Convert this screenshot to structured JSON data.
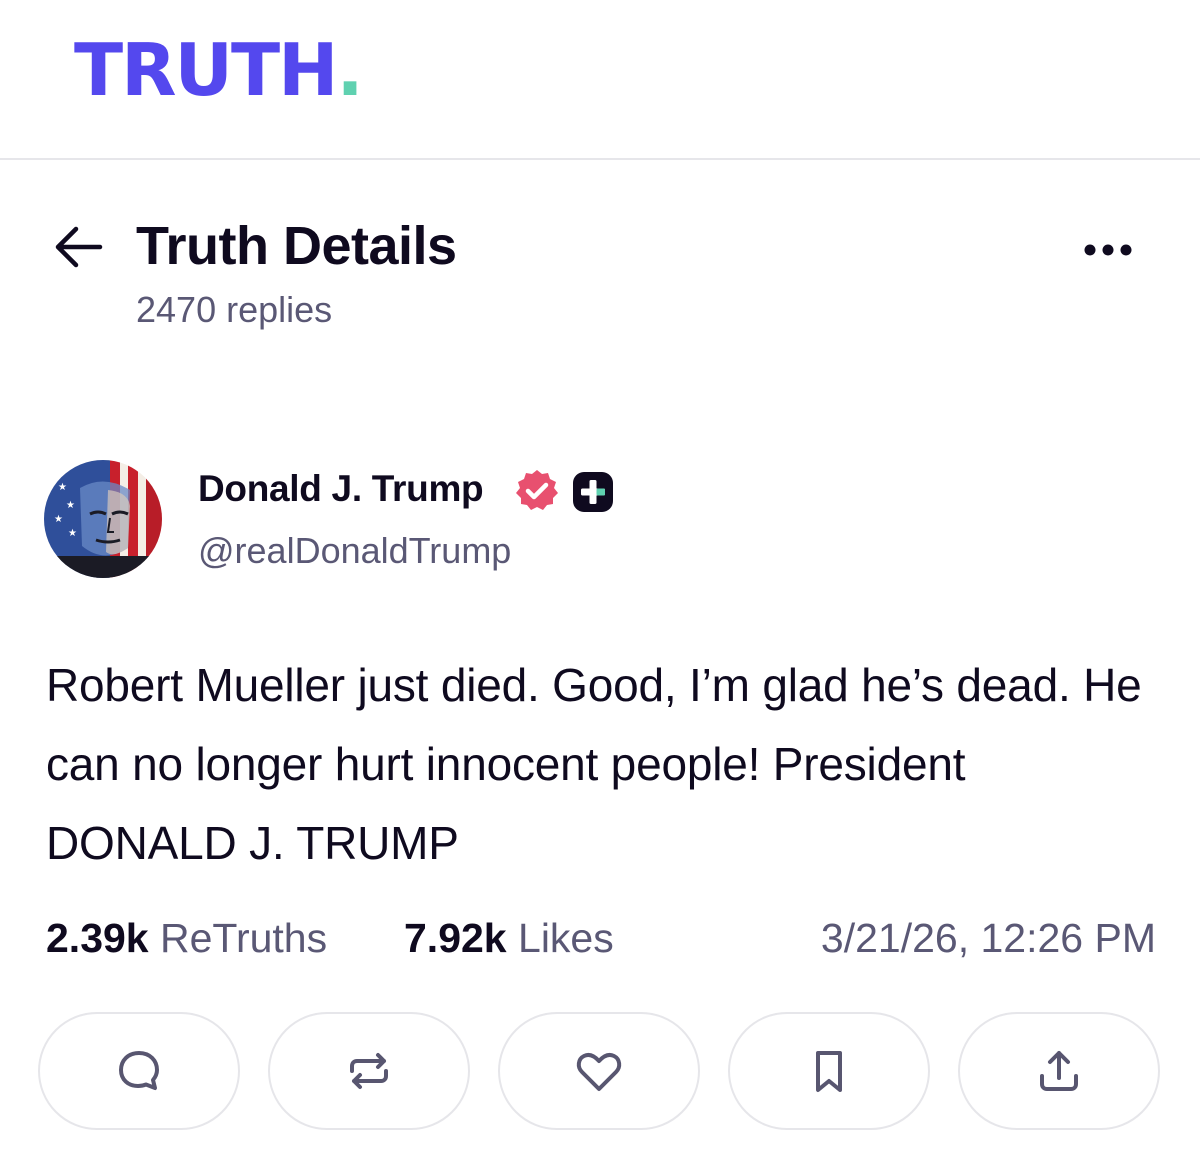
{
  "brand": {
    "logo_text": "TRUTH",
    "logo_dot": ".",
    "logo_color": "#5448ee",
    "dot_color": "#5fd1b0"
  },
  "header": {
    "back_icon": "arrow-left-icon",
    "title": "Truth Details",
    "replies": "2470 replies",
    "more_icon": "more-horizontal-icon"
  },
  "post": {
    "author": {
      "name": "Donald J. Trump",
      "handle": "@realDonaldTrump",
      "verified_icon": "verified-badge-icon",
      "verified_color": "#e8506f",
      "plus_icon": "plus-badge-icon"
    },
    "text": "Robert Mueller just died. Good, I’m glad he’s dead. He can no longer hurt innocent people! President DONALD J. TRUMP",
    "stats": {
      "retruths_count": "2.39k",
      "retruths_label": "ReTruths",
      "likes_count": "7.92k",
      "likes_label": "Likes"
    },
    "timestamp": "3/21/26, 12:26 PM"
  },
  "actions": [
    {
      "icon": "reply-icon"
    },
    {
      "icon": "retruth-icon"
    },
    {
      "icon": "heart-icon"
    },
    {
      "icon": "bookmark-icon"
    },
    {
      "icon": "share-icon"
    }
  ]
}
